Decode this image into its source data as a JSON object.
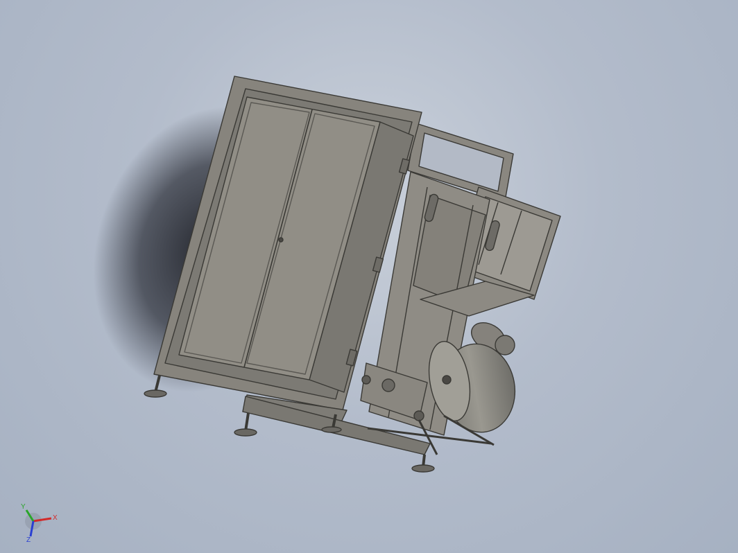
{
  "viewport": {
    "background_top": "#c9d0da",
    "background_bottom": "#a6b1c2"
  },
  "model": {
    "frame_color": "#8a8780",
    "panel_color": "#8f8c84",
    "edge_color": "#3a3935",
    "shadow_color": "#2a2c33"
  },
  "triad": {
    "x_label": "X",
    "y_label": "Y",
    "z_label": "Z",
    "x_color": "#d22a2a",
    "y_color": "#2aa52a",
    "z_color": "#2a3fd2"
  }
}
